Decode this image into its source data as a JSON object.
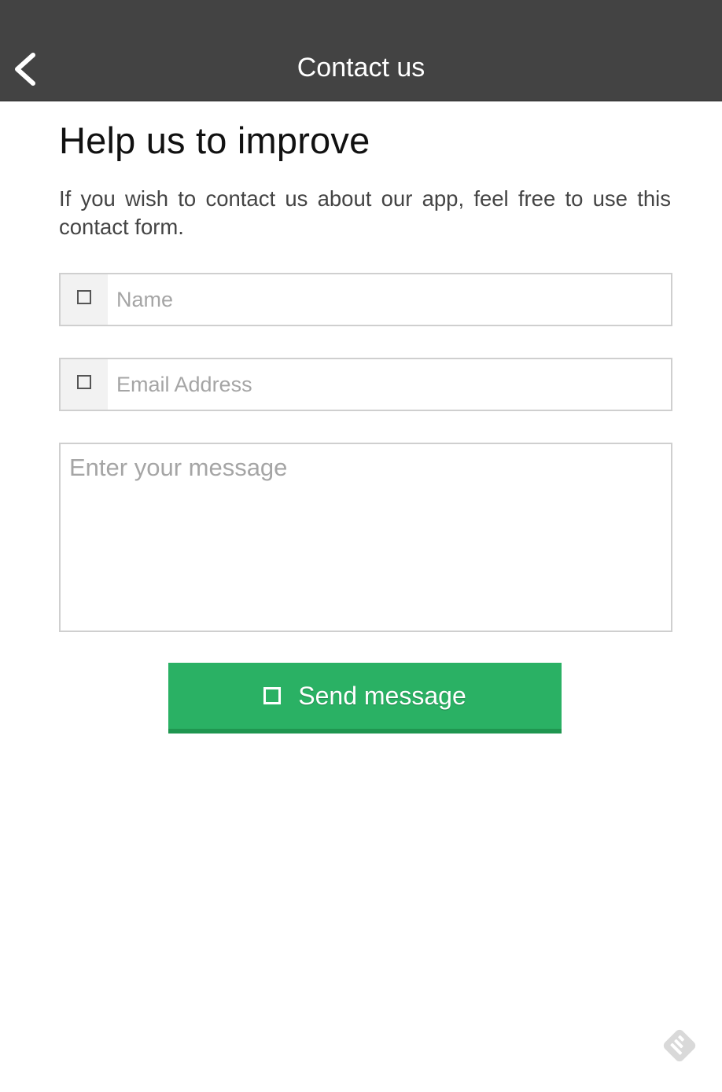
{
  "navbar": {
    "title": "Contact us",
    "back_icon": "chevron-left-icon"
  },
  "content": {
    "heading": "Help us to improve",
    "intro": "If you wish to contact us about our app, feel free to use this contact form."
  },
  "form": {
    "name": {
      "placeholder": "Name",
      "value": "",
      "icon": "user-icon"
    },
    "email": {
      "placeholder": "Email Address",
      "value": "",
      "icon": "envelope-icon"
    },
    "message": {
      "placeholder": "Enter your message",
      "value": ""
    },
    "send_button": {
      "label": "Send message",
      "icon": "send-icon"
    }
  },
  "colors": {
    "navbar_bg": "#434343",
    "button_bg": "#2ab164",
    "input_border": "#cfcfcf",
    "placeholder": "#a5a5a5"
  },
  "badge_icon": "feedly-icon"
}
